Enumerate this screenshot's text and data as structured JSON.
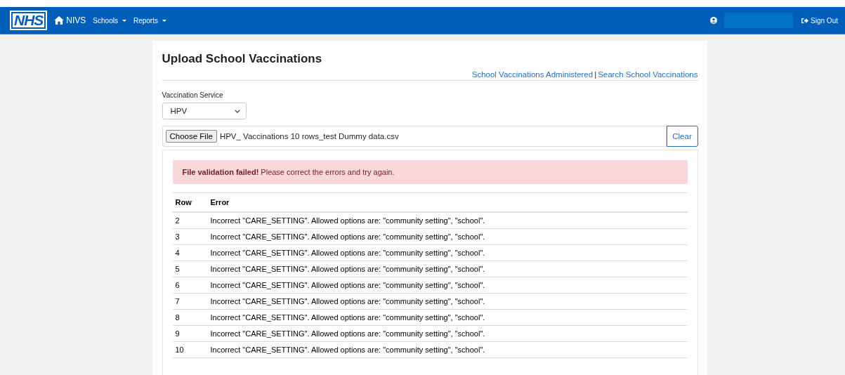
{
  "navbar": {
    "logo": "NHS",
    "brand": "NIVS",
    "menus": [
      {
        "label": "Schools"
      },
      {
        "label": "Reports"
      }
    ],
    "sign_out": "Sign Out"
  },
  "page": {
    "title": "Upload School Vaccinations",
    "links": [
      "School Vaccinations Administered",
      "Search School Vaccinations"
    ],
    "separator": "|",
    "service": {
      "label": "Vaccination Service",
      "value": "HPV"
    },
    "file": {
      "button": "Choose File",
      "filename": "HPV_ Vaccinations 10 rows_test Dummy data.csv",
      "clear": "Clear"
    },
    "alert": {
      "text": "**File validation failed!** Please correct the errors and try again."
    },
    "table": {
      "columns": [
        "Row",
        "Error"
      ],
      "rows": [
        [
          "2",
          "Incorrect \"CARE_SETTING\". Allowed options are: \"community setting\", \"school\"."
        ],
        [
          "3",
          "Incorrect \"CARE_SETTING\". Allowed options are: \"community setting\", \"school\"."
        ],
        [
          "4",
          "Incorrect \"CARE_SETTING\". Allowed options are: \"community setting\", \"school\"."
        ],
        [
          "5",
          "Incorrect \"CARE_SETTING\". Allowed options are: \"community setting\", \"school\"."
        ],
        [
          "6",
          "Incorrect \"CARE_SETTING\". Allowed options are: \"community setting\", \"school\"."
        ],
        [
          "7",
          "Incorrect \"CARE_SETTING\". Allowed options are: \"community setting\", \"school\"."
        ],
        [
          "8",
          "Incorrect \"CARE_SETTING\". Allowed options are: \"community setting\", \"school\"."
        ],
        [
          "9",
          "Incorrect \"CARE_SETTING\". Allowed options are: \"community setting\", \"school\"."
        ],
        [
          "10",
          "Incorrect \"CARE_SETTING\". Allowed options are: \"community setting\", \"school\"."
        ]
      ]
    }
  }
}
